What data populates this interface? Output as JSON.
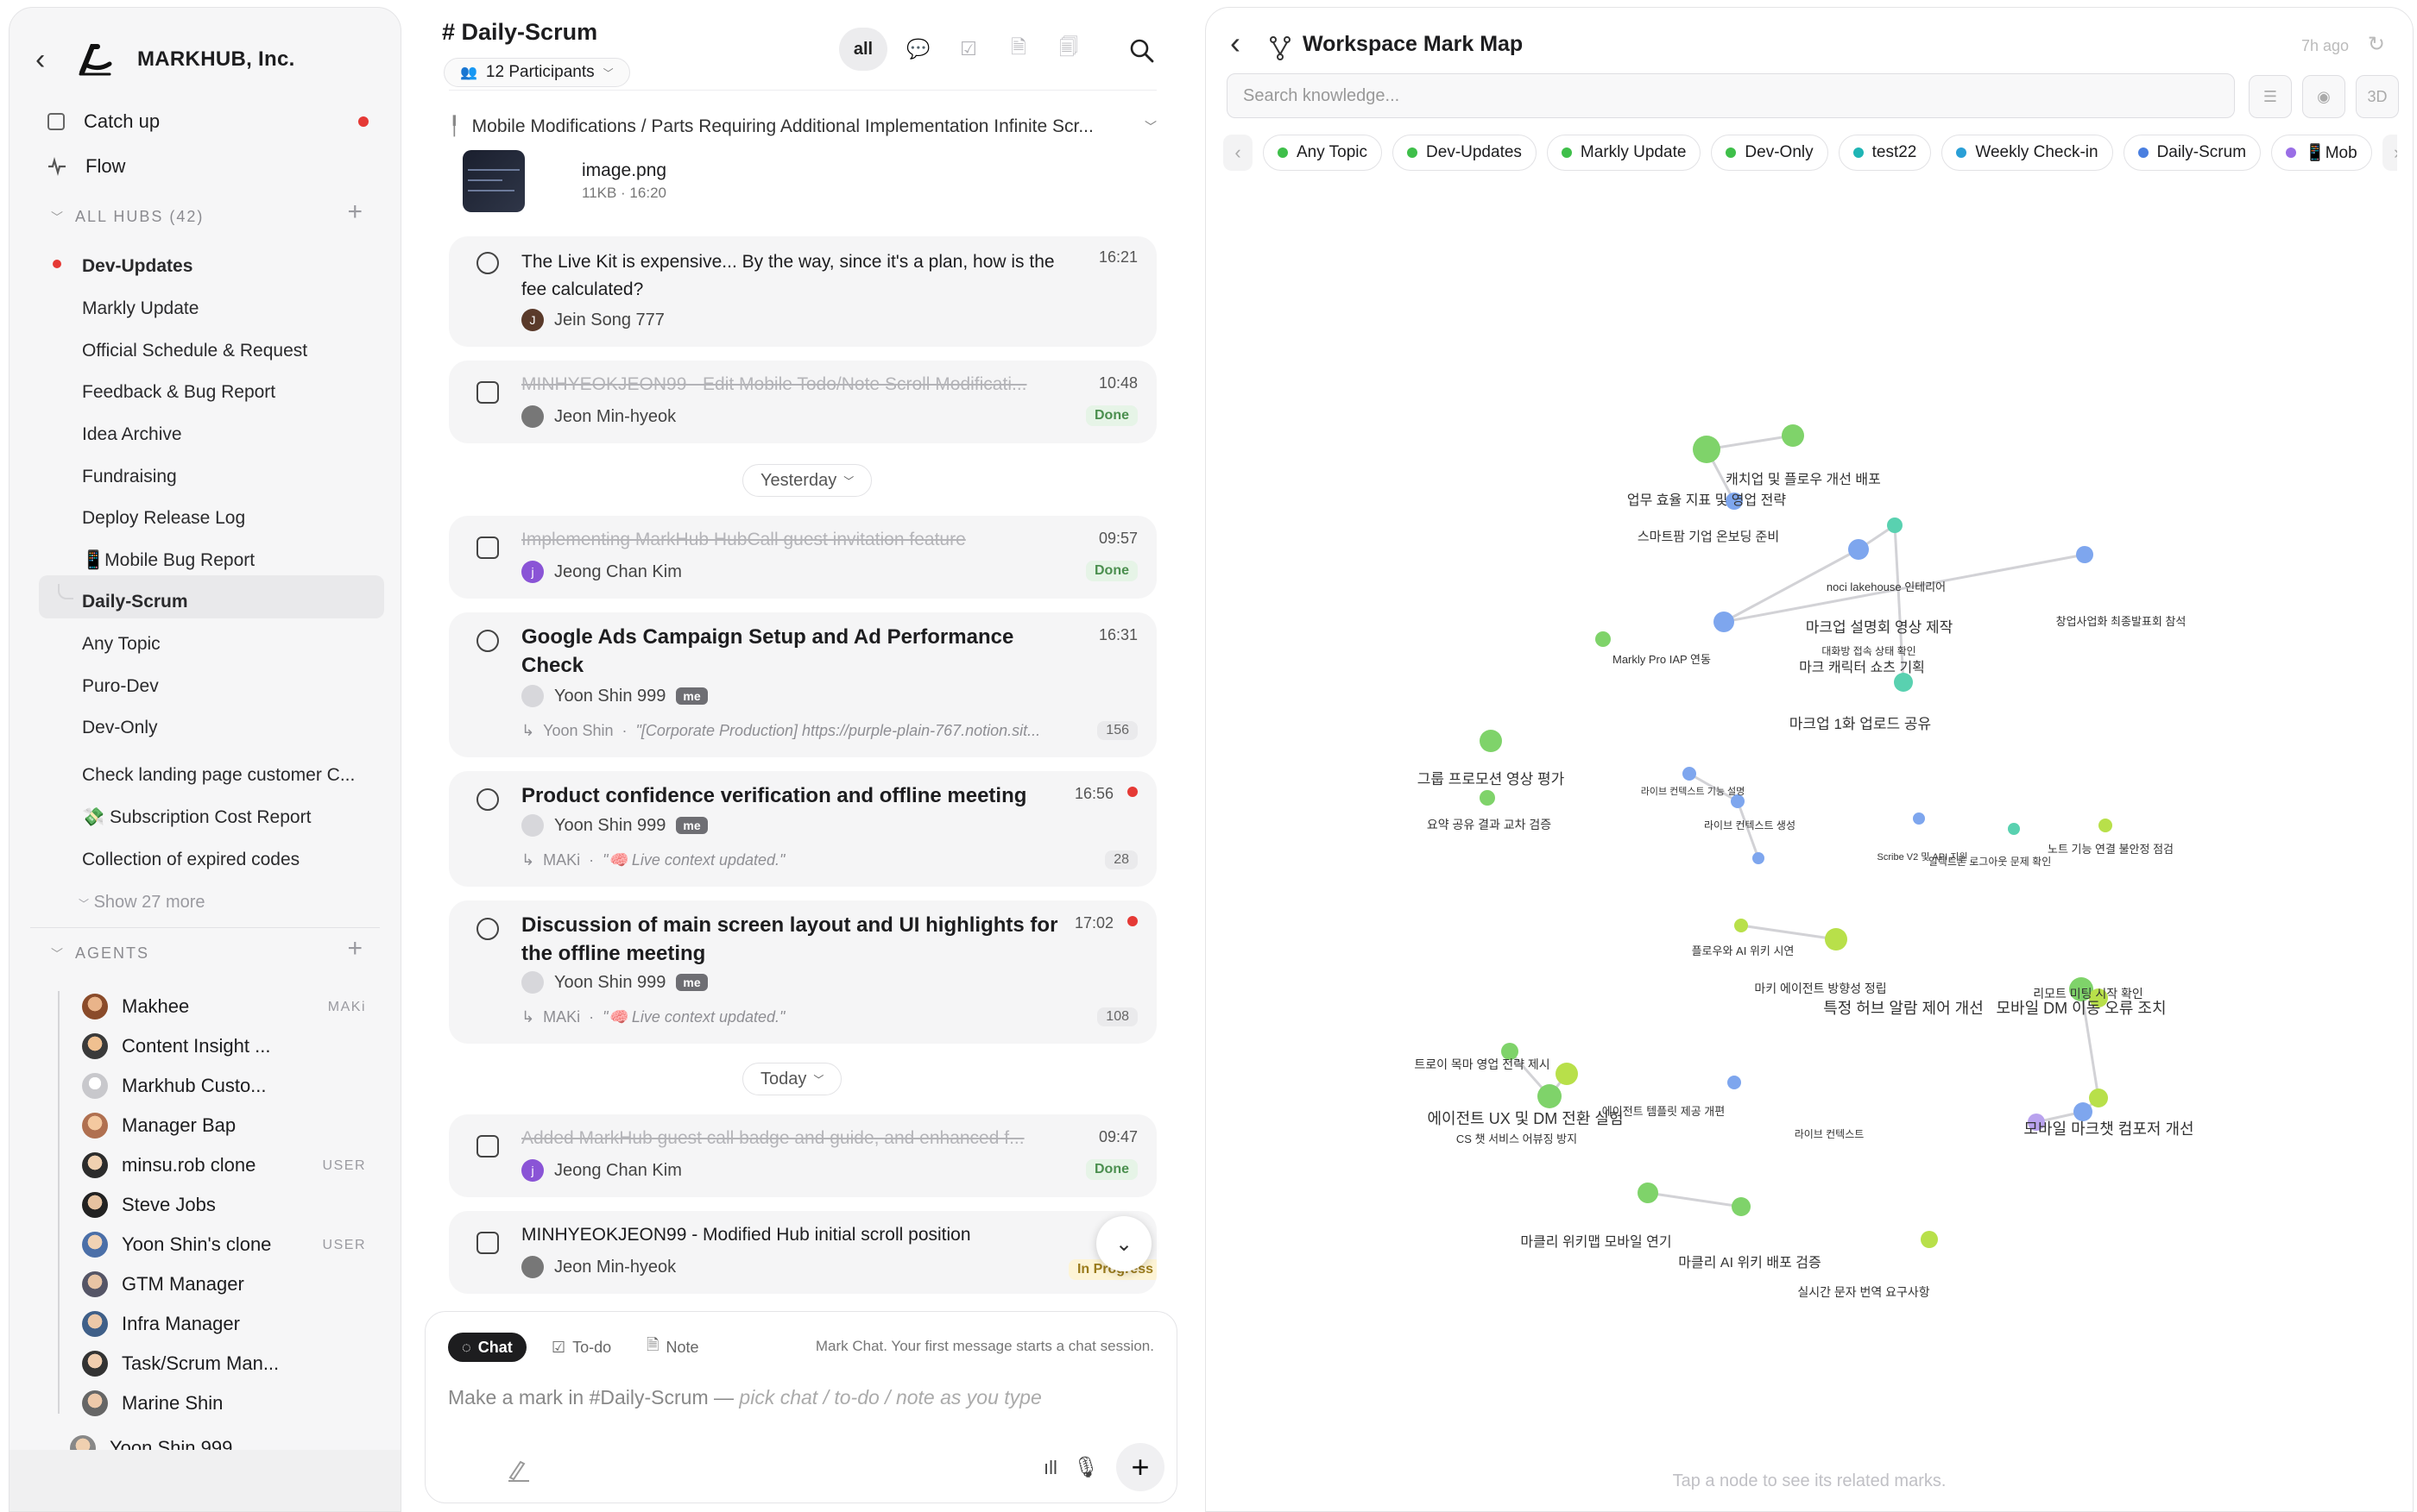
{
  "sidebar": {
    "workspace": "MARKHUB, Inc.",
    "nav": [
      {
        "label": "Catch up",
        "icon": "checkbox-icon"
      },
      {
        "label": "Flow",
        "icon": "activity-icon"
      }
    ],
    "hubs_header": "ALL HUBS (42)",
    "hubs": [
      "Dev-Updates",
      "Markly Update",
      "Official Schedule & Request",
      "Feedback & Bug Report",
      "Idea Archive",
      "Fundraising",
      "Deploy Release Log",
      "📱Mobile Bug Report",
      "Daily-Scrum",
      "Any Topic",
      "Puro-Dev",
      "Dev-Only",
      "Check landing page customer C...",
      "💸 Subscription Cost Report",
      "Collection of expired codes"
    ],
    "show_more": "Show 27 more",
    "agents_header": "AGENTS",
    "agents": [
      {
        "name": "Makhee",
        "tag": "MAKi"
      },
      {
        "name": "Content Insight ...",
        "tag": ""
      },
      {
        "name": "Markhub Custo...",
        "tag": ""
      },
      {
        "name": "Manager Bap",
        "tag": ""
      },
      {
        "name": "minsu.rob clone",
        "tag": "USER"
      },
      {
        "name": "Steve Jobs",
        "tag": ""
      },
      {
        "name": "Yoon Shin's clone",
        "tag": "USER"
      },
      {
        "name": "GTM Manager",
        "tag": ""
      },
      {
        "name": "Infra Manager",
        "tag": ""
      },
      {
        "name": "Task/Scrum Man...",
        "tag": ""
      },
      {
        "name": "Marine Shin",
        "tag": ""
      },
      {
        "name": "Yoon Shin 999",
        "tag": ""
      }
    ]
  },
  "chat": {
    "channel": "# Daily-Scrum",
    "participants": "12 Participants",
    "filter_all": "all",
    "pinned": "Mobile Modifications / Parts Requiring Additional Implementation Infinite Scr...",
    "attachment": {
      "name": "image.png",
      "meta": "11KB · 16:20"
    },
    "messages": [
      {
        "title": "The Live Kit is expensive... By the way, since it's a plan, how is the fee calculated?",
        "time": "16:21",
        "author": "Jein Song 777",
        "initial": "J"
      },
      {
        "title": "MINHYEOKJEON99 - Edit Mobile Todo/Note Scroll Modificati...",
        "time": "10:48",
        "author": "Jeon Min-hyeok",
        "status": "Done"
      },
      {
        "title": "Implementing MarkHub HubCall guest invitation feature",
        "time": "09:57",
        "author": "Jeong Chan Kim",
        "initial": "j",
        "status": "Done"
      },
      {
        "title": "Google Ads Campaign Setup and Ad Performance Check",
        "time": "16:31",
        "author": "Yoon Shin 999",
        "me": "me",
        "reply_author": "Yoon Shin",
        "reply": "\"[Corporate Production] https://purple-plain-767.notion.sit...",
        "count": "156"
      },
      {
        "title": "Product confidence verification and offline meeting",
        "time": "16:56",
        "author": "Yoon Shin 999",
        "me": "me",
        "reply_author": "MAKi",
        "reply": "\"🧠 Live context updated.\"",
        "count": "28"
      },
      {
        "title": "Discussion of main screen layout and UI highlights for the offline meeting",
        "time": "17:02",
        "author": "Yoon Shin 999",
        "me": "me",
        "reply_author": "MAKi",
        "reply": "\"🧠 Live context updated.\"",
        "count": "108"
      },
      {
        "title": "Added MarkHub guest call badge and guide, and enhanced f...",
        "time": "09:47",
        "author": "Jeong Chan Kim",
        "initial": "j",
        "status": "Done"
      },
      {
        "title": "MINHYEOKJEON99 - Modified Hub initial scroll position",
        "time": "1",
        "author": "Jeon Min-hyeok",
        "status": "In Progress"
      }
    ],
    "day_yesterday": "Yesterday",
    "day_today": "Today",
    "composer": {
      "tabs": [
        "Chat",
        "To-do",
        "Note"
      ],
      "hint": "Mark Chat. Your first message starts a chat session.",
      "placeholder_a": "Make a mark in #Daily-Scrum — ",
      "placeholder_b": "pick chat / to-do / note as you type"
    }
  },
  "map": {
    "title": "Workspace Mark Map",
    "updated": "7h ago",
    "search_placeholder": "Search knowledge...",
    "mode": "3D",
    "chips": [
      {
        "label": "Any Topic",
        "color": "#3fbf4a"
      },
      {
        "label": "Dev-Updates",
        "color": "#3fbf4a"
      },
      {
        "label": "Markly Update",
        "color": "#3fbf4a"
      },
      {
        "label": "Dev-Only",
        "color": "#3fbf4a"
      },
      {
        "label": "test22",
        "color": "#1fb5b5"
      },
      {
        "label": "Weekly Check-in",
        "color": "#2a9fd6"
      },
      {
        "label": "Daily-Scrum",
        "color": "#4a7fe0"
      },
      {
        "label": "📱Mob",
        "color": "#9a6ee6"
      }
    ],
    "labels": [
      "캐치업 및 플로우 개선 배포",
      "업무 효율 지표 및 영업 전략",
      "스마트팜 기업 온보딩 준비",
      "noci lakehouse 인테리어",
      "창업사업화 최종발표회 참석",
      "마크업 설명회 영상 제작",
      "대화방 접속 상태 확인",
      "Markly Pro IAP 연동",
      "마크 캐릭터 쇼츠 기획",
      "마크업 1화 업로드 공유",
      "그룹 프로모션 영상 평가",
      "요약 공유 결과 교차 검증",
      "라이브 컨텍스트 기능 설명",
      "라이브 컨텍스트 생성",
      "노트 기능 연결 불안정 점검",
      "Scribe V2 및 API 지원",
      "일렉트론 로그아웃 문제 확인",
      "플로우와 AI 위키 시연",
      "마키 에이전트 방향성 정립",
      "특정 허브 알람 제어 개선",
      "리모트 미팅 시작 확인",
      "모바일 DM 이동 오류 조치",
      "트로이 목마 영업 전략 제시",
      "에이전트 UX 및 DM 전환 실험",
      "CS 챗 서비스 어뷰징 방지",
      "에이전트 템플릿 제공 개편",
      "라이브 컨텍스트",
      "모바일 마크챗 컴포저 개선",
      "마클리 위키맵 모바일 연기",
      "마클리 AI 위키 배포 검증",
      "실시간 문자 번역 요구사항"
    ],
    "hint": "Tap a node to see its related marks."
  }
}
